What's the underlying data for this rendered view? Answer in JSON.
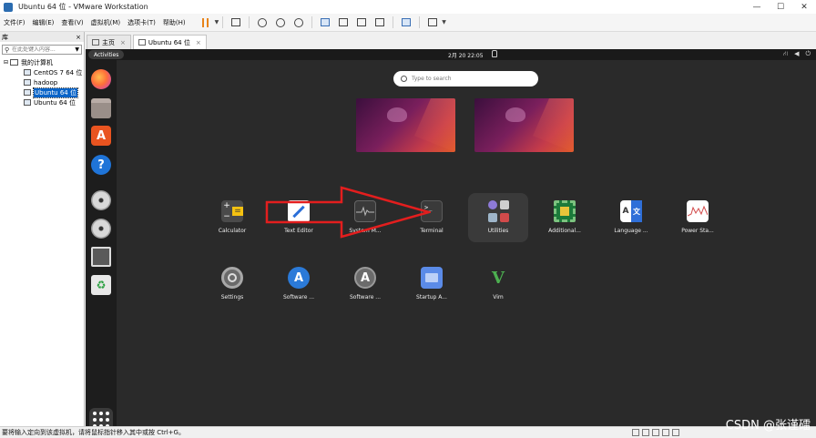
{
  "window": {
    "title": "Ubuntu 64 位 - VMware Workstation",
    "controls": [
      "—",
      "☐",
      "✕"
    ]
  },
  "menu": [
    "文件(F)",
    "编辑(E)",
    "查看(V)",
    "虚拟机(M)",
    "选项卡(T)",
    "帮助(H)"
  ],
  "library": {
    "title": "库",
    "close": "×",
    "search_placeholder": "在此处键入内容...",
    "tree": {
      "root": "我的计算机",
      "children": [
        "CentOS 7 64 位",
        "hadoop",
        "Ubuntu 64 位",
        "Ubuntu 64 位"
      ]
    }
  },
  "tabs": [
    {
      "label": "主页"
    },
    {
      "label": "Ubuntu 64 位"
    }
  ],
  "ubuntu": {
    "activities": "Activities",
    "clock": "2月 20  22:05",
    "search_placeholder": "Type to search",
    "apps_row1": [
      "Calculator",
      "Text Editor",
      "System M...",
      "Terminal",
      "Utilities",
      "Additional...",
      "Language ...",
      "Power Sta..."
    ],
    "apps_row2": [
      "Settings",
      "Software ...",
      "Software ...",
      "Startup A...",
      "Vim"
    ],
    "terminal_prompt": ">_",
    "calc_keys": [
      "+",
      "−",
      "="
    ],
    "lang_keys": [
      "A",
      "文"
    ],
    "vim_glyph": "V"
  },
  "status": {
    "message": "要将输入定向到该虚拟机，请将鼠标指针移入其中或按 Ctrl+G。"
  },
  "watermark": "CSDN @张谨礌",
  "colors": {
    "accent": "#e95420",
    "arrow": "#e31e1e",
    "selection": "#0a64c8"
  }
}
